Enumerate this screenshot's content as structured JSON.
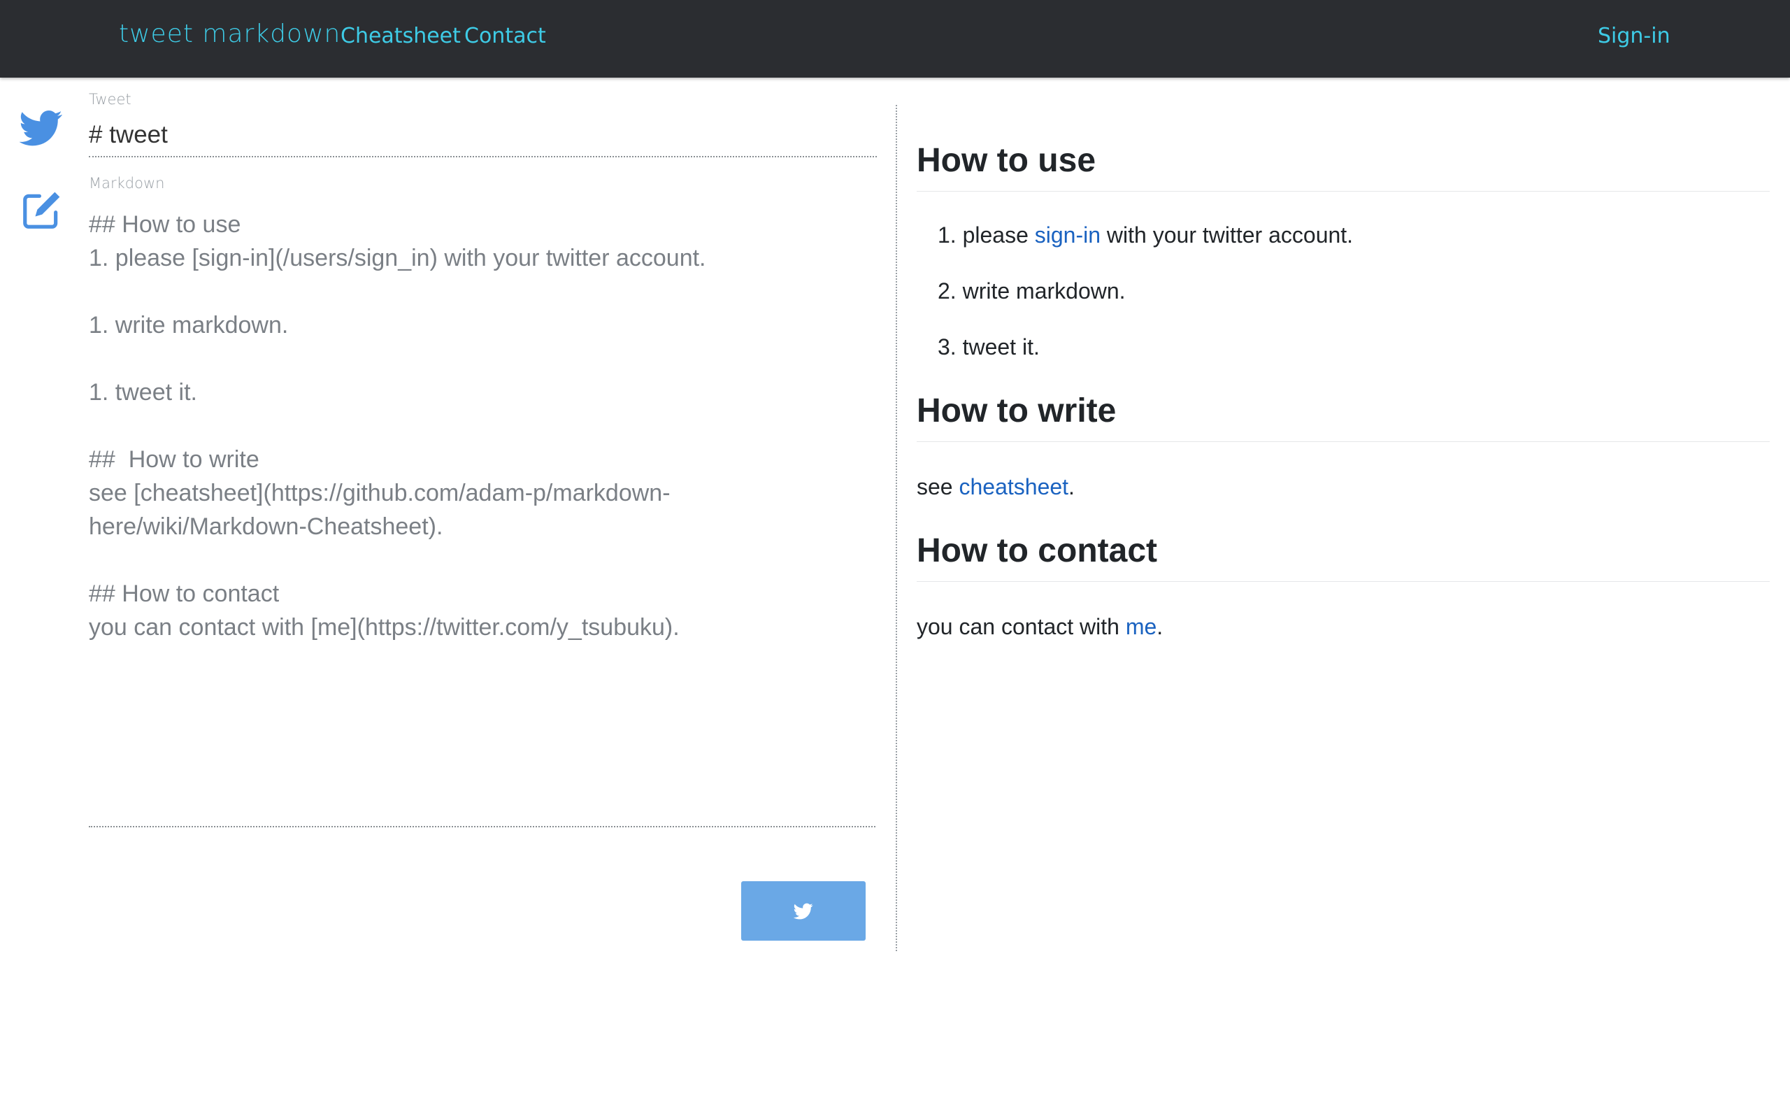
{
  "navbar": {
    "brand": "tweet markdown",
    "links": {
      "cheatsheet": "Cheatsheet",
      "contact": "Contact",
      "signin": "Sign-in"
    }
  },
  "colors": {
    "navbar_bg": "#2b2d31",
    "accent": "#3ecbe6",
    "link": "#1a62c0",
    "tweet_button": "#6aa8e6",
    "icon_blue": "#4a90e2"
  },
  "icons": {
    "sidebar_top": "twitter-bird-icon",
    "sidebar_bottom": "edit-icon",
    "button": "twitter-bird-icon"
  },
  "editor": {
    "tweet_label": "Tweet",
    "tweet_value": "# tweet",
    "markdown_label": "Markdown",
    "markdown_value": "## How to use\n1. please [sign-in](/users/sign_in) with your twitter account.\n\n1. write markdown.\n\n1. tweet it.\n\n##  How to write\nsee [cheatsheet](https://github.com/adam-p/markdown-here/wiki/Markdown-Cheatsheet).\n\n## How to contact\nyou can contact with [me](https://twitter.com/y_tsubuku)."
  },
  "preview": {
    "how_to_use": {
      "heading": "How to use",
      "items": [
        {
          "num": "1.",
          "before": "please ",
          "link": "sign-in",
          "after": " with your twitter account."
        },
        {
          "num": "2.",
          "text": "write markdown."
        },
        {
          "num": "3.",
          "text": "tweet it."
        }
      ]
    },
    "how_to_write": {
      "heading": "How to write",
      "before": "see ",
      "link": "cheatsheet",
      "after": "."
    },
    "how_to_contact": {
      "heading": "How to contact",
      "before": "you can contact with ",
      "link": "me",
      "after": "."
    }
  }
}
